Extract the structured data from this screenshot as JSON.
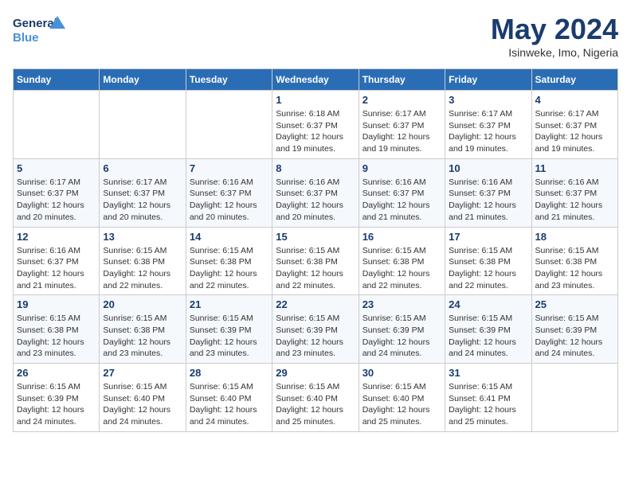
{
  "header": {
    "logo_line1": "General",
    "logo_line2": "Blue",
    "month_title": "May 2024",
    "location": "Isinweke, Imo, Nigeria"
  },
  "days_of_week": [
    "Sunday",
    "Monday",
    "Tuesday",
    "Wednesday",
    "Thursday",
    "Friday",
    "Saturday"
  ],
  "weeks": [
    [
      {
        "num": "",
        "info": ""
      },
      {
        "num": "",
        "info": ""
      },
      {
        "num": "",
        "info": ""
      },
      {
        "num": "1",
        "info": "Sunrise: 6:18 AM\nSunset: 6:37 PM\nDaylight: 12 hours and 19 minutes."
      },
      {
        "num": "2",
        "info": "Sunrise: 6:17 AM\nSunset: 6:37 PM\nDaylight: 12 hours and 19 minutes."
      },
      {
        "num": "3",
        "info": "Sunrise: 6:17 AM\nSunset: 6:37 PM\nDaylight: 12 hours and 19 minutes."
      },
      {
        "num": "4",
        "info": "Sunrise: 6:17 AM\nSunset: 6:37 PM\nDaylight: 12 hours and 19 minutes."
      }
    ],
    [
      {
        "num": "5",
        "info": "Sunrise: 6:17 AM\nSunset: 6:37 PM\nDaylight: 12 hours and 20 minutes."
      },
      {
        "num": "6",
        "info": "Sunrise: 6:17 AM\nSunset: 6:37 PM\nDaylight: 12 hours and 20 minutes."
      },
      {
        "num": "7",
        "info": "Sunrise: 6:16 AM\nSunset: 6:37 PM\nDaylight: 12 hours and 20 minutes."
      },
      {
        "num": "8",
        "info": "Sunrise: 6:16 AM\nSunset: 6:37 PM\nDaylight: 12 hours and 20 minutes."
      },
      {
        "num": "9",
        "info": "Sunrise: 6:16 AM\nSunset: 6:37 PM\nDaylight: 12 hours and 21 minutes."
      },
      {
        "num": "10",
        "info": "Sunrise: 6:16 AM\nSunset: 6:37 PM\nDaylight: 12 hours and 21 minutes."
      },
      {
        "num": "11",
        "info": "Sunrise: 6:16 AM\nSunset: 6:37 PM\nDaylight: 12 hours and 21 minutes."
      }
    ],
    [
      {
        "num": "12",
        "info": "Sunrise: 6:16 AM\nSunset: 6:37 PM\nDaylight: 12 hours and 21 minutes."
      },
      {
        "num": "13",
        "info": "Sunrise: 6:15 AM\nSunset: 6:38 PM\nDaylight: 12 hours and 22 minutes."
      },
      {
        "num": "14",
        "info": "Sunrise: 6:15 AM\nSunset: 6:38 PM\nDaylight: 12 hours and 22 minutes."
      },
      {
        "num": "15",
        "info": "Sunrise: 6:15 AM\nSunset: 6:38 PM\nDaylight: 12 hours and 22 minutes."
      },
      {
        "num": "16",
        "info": "Sunrise: 6:15 AM\nSunset: 6:38 PM\nDaylight: 12 hours and 22 minutes."
      },
      {
        "num": "17",
        "info": "Sunrise: 6:15 AM\nSunset: 6:38 PM\nDaylight: 12 hours and 22 minutes."
      },
      {
        "num": "18",
        "info": "Sunrise: 6:15 AM\nSunset: 6:38 PM\nDaylight: 12 hours and 23 minutes."
      }
    ],
    [
      {
        "num": "19",
        "info": "Sunrise: 6:15 AM\nSunset: 6:38 PM\nDaylight: 12 hours and 23 minutes."
      },
      {
        "num": "20",
        "info": "Sunrise: 6:15 AM\nSunset: 6:38 PM\nDaylight: 12 hours and 23 minutes."
      },
      {
        "num": "21",
        "info": "Sunrise: 6:15 AM\nSunset: 6:39 PM\nDaylight: 12 hours and 23 minutes."
      },
      {
        "num": "22",
        "info": "Sunrise: 6:15 AM\nSunset: 6:39 PM\nDaylight: 12 hours and 23 minutes."
      },
      {
        "num": "23",
        "info": "Sunrise: 6:15 AM\nSunset: 6:39 PM\nDaylight: 12 hours and 24 minutes."
      },
      {
        "num": "24",
        "info": "Sunrise: 6:15 AM\nSunset: 6:39 PM\nDaylight: 12 hours and 24 minutes."
      },
      {
        "num": "25",
        "info": "Sunrise: 6:15 AM\nSunset: 6:39 PM\nDaylight: 12 hours and 24 minutes."
      }
    ],
    [
      {
        "num": "26",
        "info": "Sunrise: 6:15 AM\nSunset: 6:39 PM\nDaylight: 12 hours and 24 minutes."
      },
      {
        "num": "27",
        "info": "Sunrise: 6:15 AM\nSunset: 6:40 PM\nDaylight: 12 hours and 24 minutes."
      },
      {
        "num": "28",
        "info": "Sunrise: 6:15 AM\nSunset: 6:40 PM\nDaylight: 12 hours and 24 minutes."
      },
      {
        "num": "29",
        "info": "Sunrise: 6:15 AM\nSunset: 6:40 PM\nDaylight: 12 hours and 25 minutes."
      },
      {
        "num": "30",
        "info": "Sunrise: 6:15 AM\nSunset: 6:40 PM\nDaylight: 12 hours and 25 minutes."
      },
      {
        "num": "31",
        "info": "Sunrise: 6:15 AM\nSunset: 6:41 PM\nDaylight: 12 hours and 25 minutes."
      },
      {
        "num": "",
        "info": ""
      }
    ]
  ]
}
